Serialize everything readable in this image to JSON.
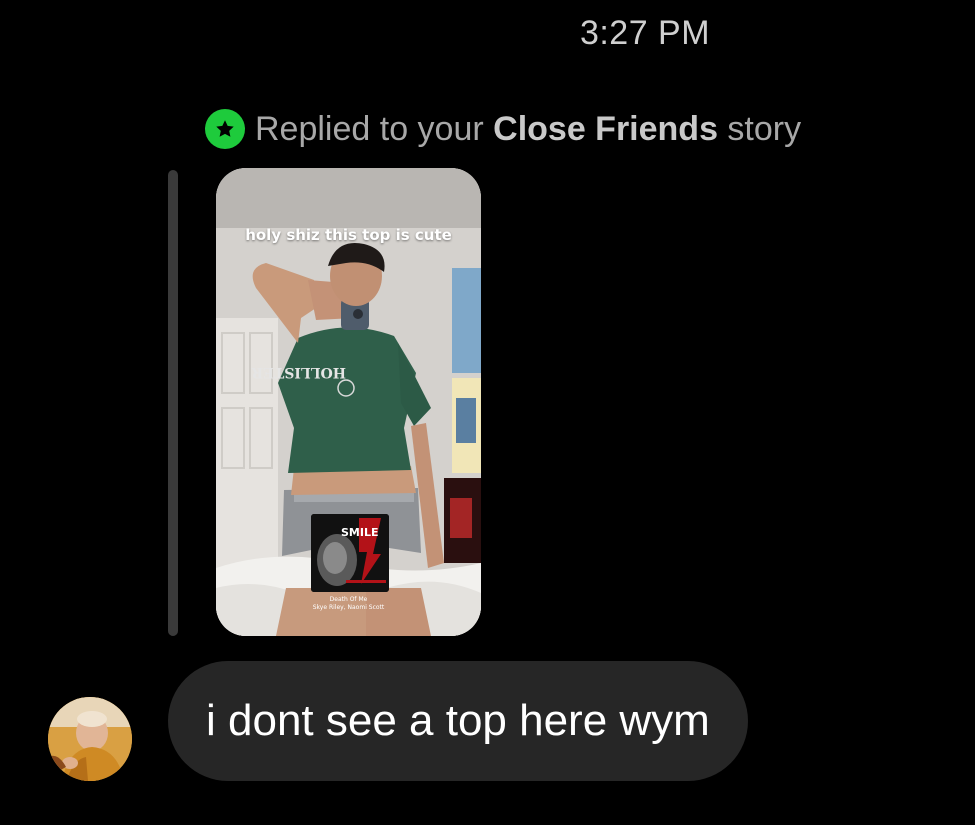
{
  "timestamp": "3:27 PM",
  "reply_header": {
    "prefix": "Replied to your ",
    "emphasis": "Close Friends",
    "suffix": " story",
    "badge_icon": "star-icon",
    "badge_color": "#1ecb3c"
  },
  "story": {
    "caption": "holy shiz this top is cute",
    "music_sticker": {
      "title": "SMILE",
      "song": "Death Of Me",
      "artists": "Skye Riley, Naomi Scott"
    }
  },
  "message": {
    "text": "i dont see a top here wym",
    "sender_avatar": "avatar"
  }
}
